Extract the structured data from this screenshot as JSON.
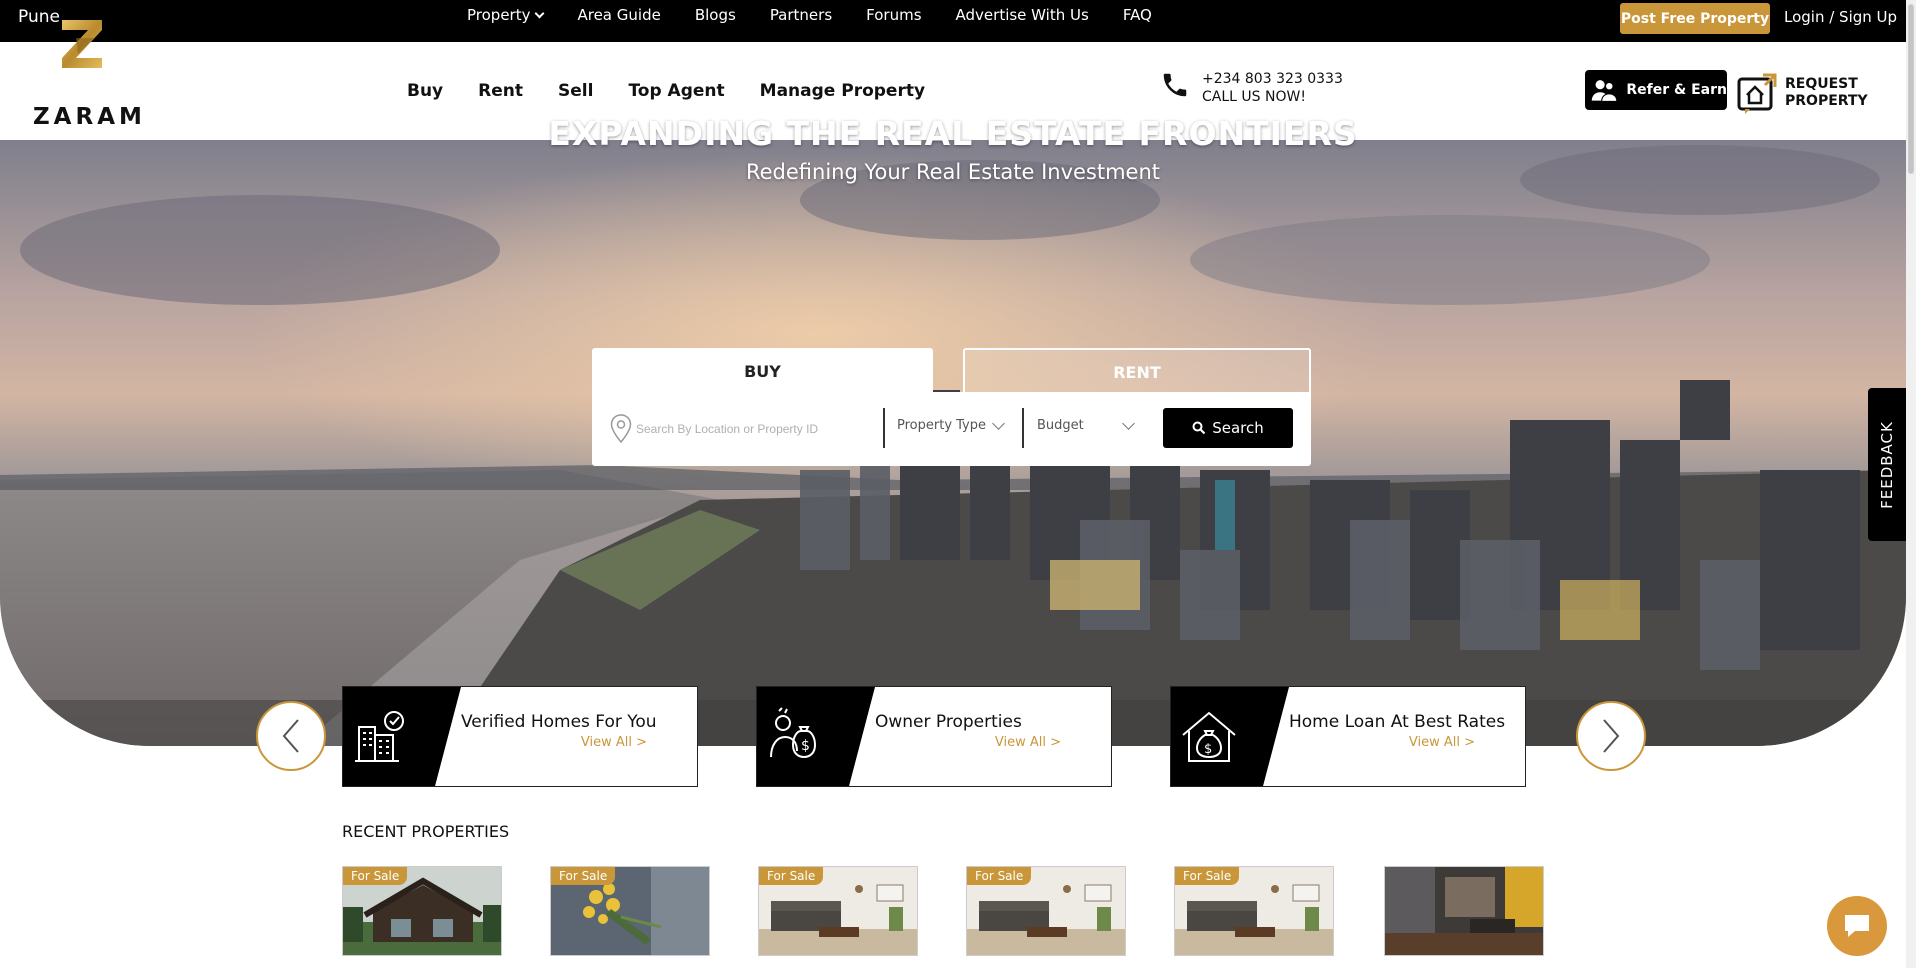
{
  "topbar": {
    "city": "Pune",
    "nav": [
      {
        "label": "Property",
        "has_dropdown": true
      },
      {
        "label": "Area Guide"
      },
      {
        "label": "Blogs"
      },
      {
        "label": "Partners"
      },
      {
        "label": "Forums"
      },
      {
        "label": "Advertise With Us"
      },
      {
        "label": "FAQ"
      }
    ],
    "post_button": "Post Free Property",
    "login": "Login / Sign Up"
  },
  "header": {
    "logo_text": "ZARAM",
    "nav": [
      "Buy",
      "Rent",
      "Sell",
      "Top Agent",
      "Manage Property"
    ],
    "phone_number": "+234 803 323 0333",
    "phone_cta": "CALL US NOW!",
    "refer_label": "Refer & Earn",
    "request_line1": "REQUEST",
    "request_line2": "PROPERTY"
  },
  "hero": {
    "title": "EXPANDING THE REAL ESTATE FRONTIERS",
    "subtitle": "Redefining Your Real Estate Investment",
    "tabs": {
      "buy": "BUY",
      "rent": "RENT",
      "active": "BUY"
    },
    "search": {
      "placeholder": "Search By Location or Property ID",
      "property_type": "Property Type",
      "budget": "Budget",
      "button": "Search"
    }
  },
  "feedback": "FEEDBACK",
  "cards": [
    {
      "title": "Verified Homes For You",
      "link": "View All >",
      "icon": "building-verified-icon"
    },
    {
      "title": "Owner Properties",
      "link": "View All >",
      "icon": "owner-money-icon"
    },
    {
      "title": "Home Loan At Best Rates",
      "link": "View All >",
      "icon": "house-loan-icon"
    }
  ],
  "recent": {
    "title": "RECENT PROPERTIES",
    "items": [
      {
        "badge": "For Sale",
        "scene": "cabin"
      },
      {
        "badge": "For Sale",
        "scene": "flowers"
      },
      {
        "badge": "For Sale",
        "scene": "living-room"
      },
      {
        "badge": "For Sale",
        "scene": "living-room"
      },
      {
        "badge": "For Sale",
        "scene": "living-room"
      },
      {
        "badge": "",
        "scene": "interior-dark"
      }
    ]
  },
  "colors": {
    "accent": "#c9973a",
    "dark": "#000000"
  }
}
